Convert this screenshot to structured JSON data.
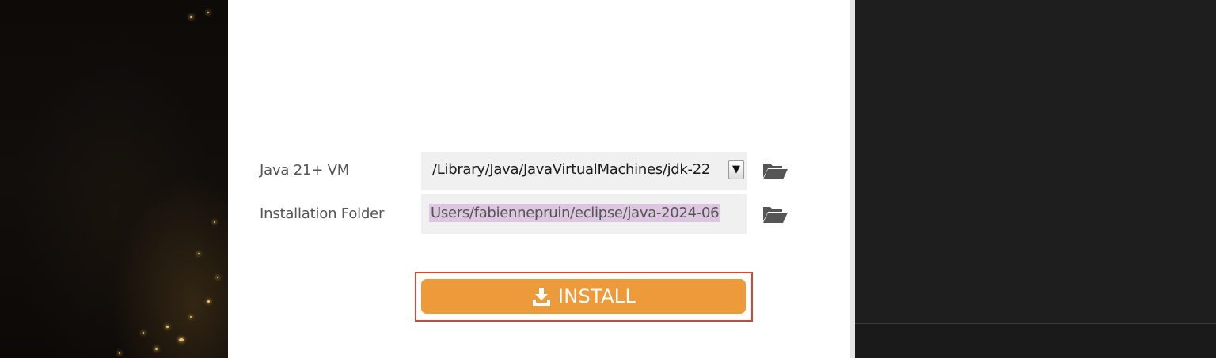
{
  "installer": {
    "jvm_label": "Java 21+ VM",
    "jvm_value": "/Library/Java/JavaVirtualMachines/jdk-22",
    "jvm_dropdown_glyph": "▼",
    "folder_label": "Installation Folder",
    "folder_value": "Users/fabiennepruin/eclipse/java-2024-06",
    "install_label": "INSTALL"
  },
  "icons": {
    "folder": "folder-open-icon",
    "install": "download-icon"
  },
  "colors": {
    "install_button": "#ec9a3a",
    "highlight_border": "#d9462f",
    "selection": "#dcc6e0",
    "dialog_background": "#ffffff",
    "right_panel": "#1e1e1e"
  }
}
